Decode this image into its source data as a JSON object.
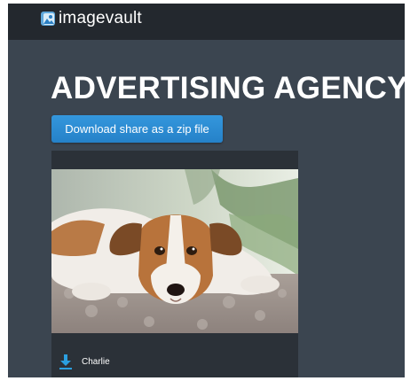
{
  "header": {
    "brand_name": "imagevault",
    "logo_icon": "imagevault-logo-icon"
  },
  "main": {
    "title": "ADVERTISING AGENCY",
    "download_button_label": "Download share as a zip file"
  },
  "asset_card": {
    "image_subject": "jack-russell-dog-photo",
    "download_icon": "download-icon",
    "caption": "Charlie"
  },
  "colors": {
    "page_background": "#3b4550",
    "top_bar": "#23282e",
    "button": "#2a8ad3",
    "card": "#2b3138",
    "download_icon": "#2b9fe0"
  }
}
